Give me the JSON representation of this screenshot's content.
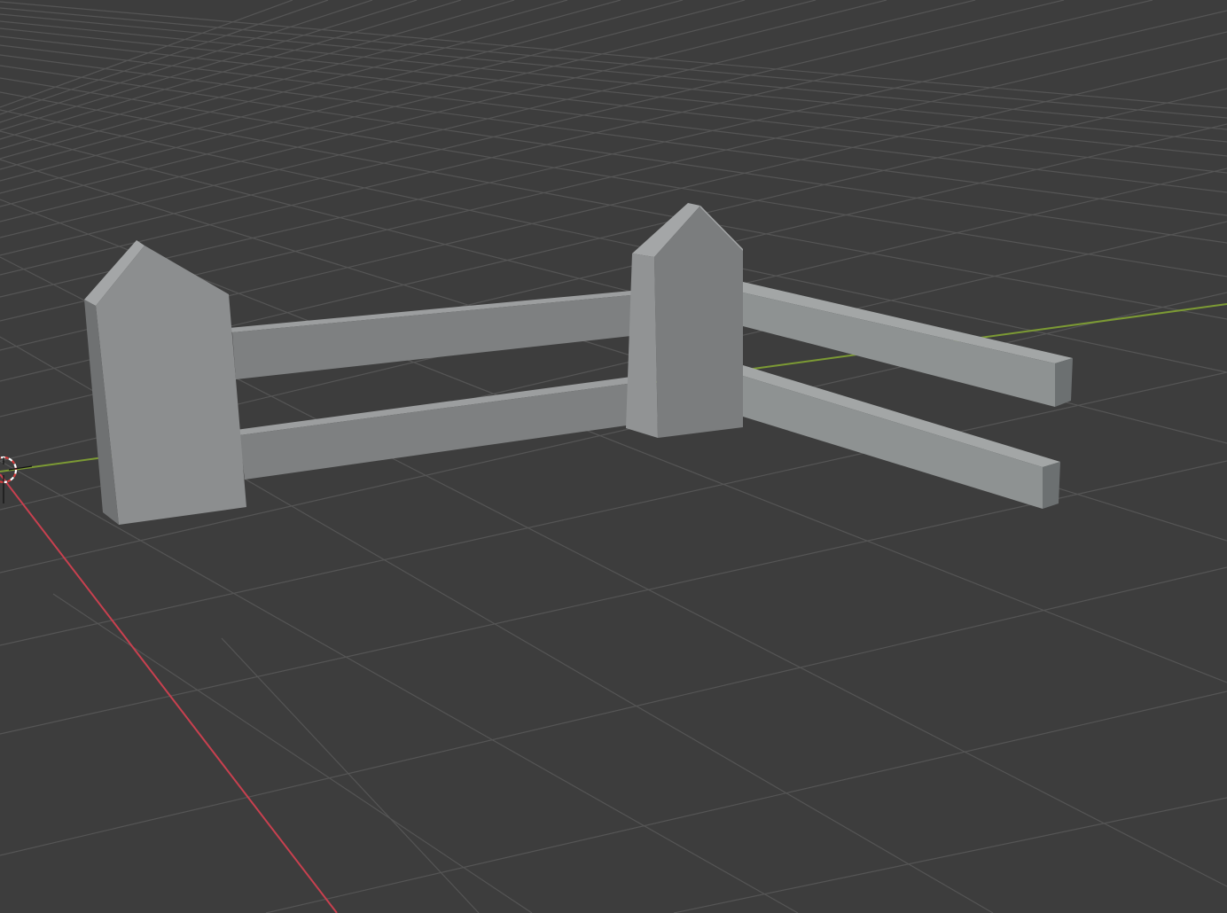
{
  "viewport": {
    "kind": "3d-viewport",
    "background_color": "#3d3d3d",
    "grid_color": "#545454",
    "x_axis_color": "#c8404f",
    "y_axis_color": "#7c9a34",
    "object_colors": {
      "front": "#8e9091",
      "side": "#6f7172",
      "top": "#a9abac",
      "rail_front": "#808283",
      "rail_top": "#9c9e9f",
      "far_rail_front": "#8e9292",
      "far_rail_top": "#a3a6a6"
    },
    "scene_objects": [
      {
        "name": "fence-post-left"
      },
      {
        "name": "fence-post-right"
      },
      {
        "name": "fence-rail-upper-left"
      },
      {
        "name": "fence-rail-lower-left"
      },
      {
        "name": "fence-rail-upper-right"
      },
      {
        "name": "fence-rail-lower-right"
      }
    ],
    "cursor": {
      "name": "3d-cursor-icon"
    }
  }
}
